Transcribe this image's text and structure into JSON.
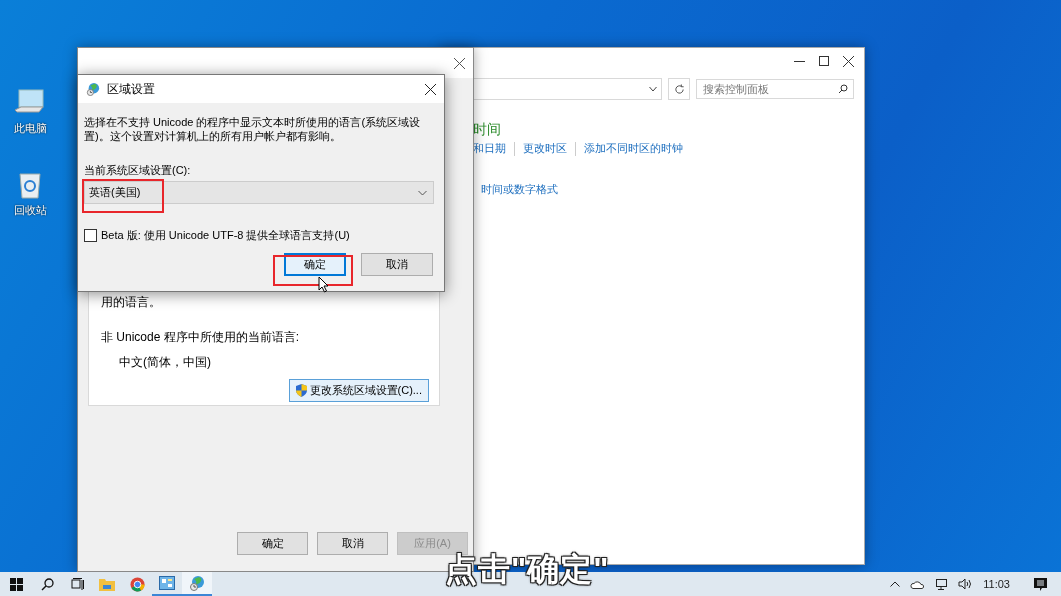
{
  "desktop_icons": [
    {
      "kind": "computer",
      "label": "此电脑"
    },
    {
      "kind": "recycle-bin",
      "label": "回收站"
    }
  ],
  "control_panel": {
    "search": {
      "placeholder": "搜索控制面板"
    },
    "heading": "时间",
    "links": [
      "和日期",
      "更改时区",
      "添加不同时区的时钟"
    ],
    "link_2": "时间或数字格式"
  },
  "region_window": {
    "note": "用的语言。",
    "label": "非 Unicode 程序中所使用的当前语言:",
    "current_language": "中文(简体，中国)",
    "change_button": "更改系统区域设置(C)...",
    "buttons": [
      {
        "label": "确定",
        "disabled": false
      },
      {
        "label": "取消",
        "disabled": false
      },
      {
        "label": "应用(A)",
        "disabled": true
      }
    ]
  },
  "dialog": {
    "title": "区域设置",
    "description": "选择在不支持 Unicode 的程序中显示文本时所使用的语言(系统区域设置)。这个设置对计算机上的所有用户帐户都有影响。",
    "locale_label": "当前系统区域设置(C):",
    "locale": {
      "value": "英语(美国)"
    },
    "beta_option": {
      "label": "Beta 版: 使用 Unicode UTF-8 提供全球语言支持(U)",
      "checked": false
    },
    "buttons": [
      {
        "label": "确定",
        "focused": true
      },
      {
        "label": "取消",
        "focused": false
      }
    ]
  },
  "taskbar": {
    "apps": [
      {
        "kind": "explorer",
        "running": false,
        "selected": false
      },
      {
        "kind": "chrome",
        "running": false,
        "selected": false
      },
      {
        "kind": "control-panel",
        "running": true,
        "selected": false
      },
      {
        "kind": "region",
        "running": true,
        "selected": true
      }
    ],
    "clock": "11:03"
  },
  "caption": "点击\"确定\""
}
